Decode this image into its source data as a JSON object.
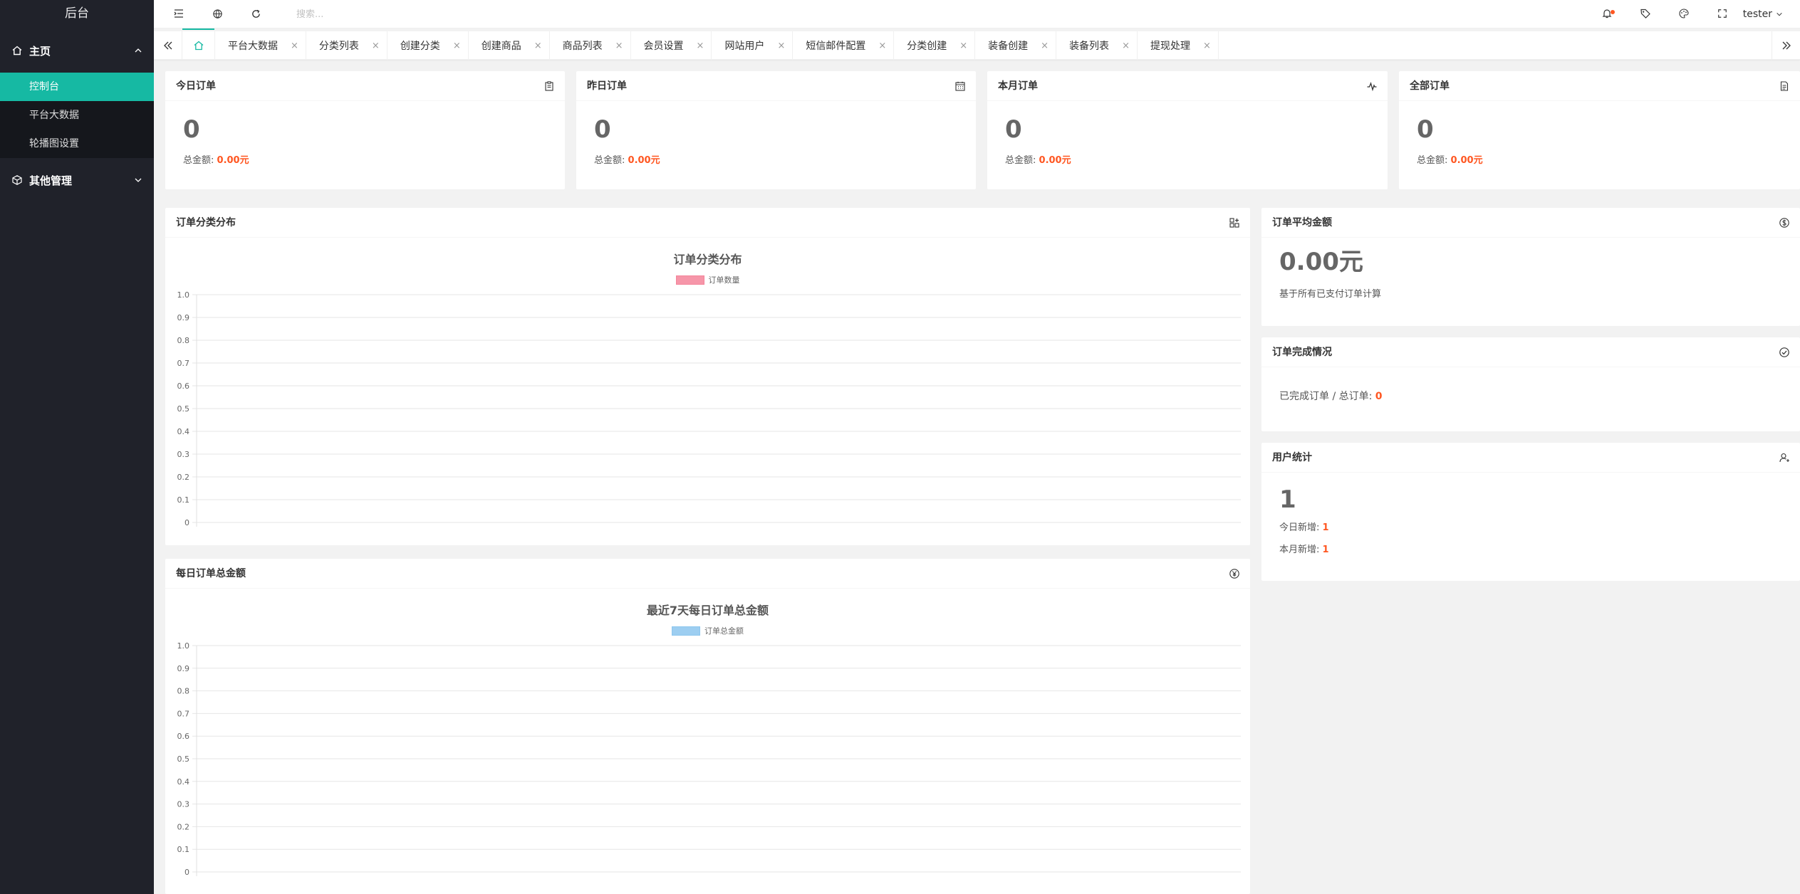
{
  "app": {
    "title": "后台"
  },
  "sidebar": {
    "groups": [
      {
        "label": "主页",
        "icon": "home-icon",
        "expanded": true,
        "items": [
          {
            "label": "控制台",
            "active": true
          },
          {
            "label": "平台大数据"
          },
          {
            "label": "轮播图设置"
          }
        ]
      },
      {
        "label": "其他管理",
        "icon": "cube-icon",
        "expanded": false,
        "items": []
      }
    ]
  },
  "header": {
    "search_placeholder": "搜索...",
    "user": "tester",
    "has_notification": true
  },
  "tabs": {
    "items": [
      "平台大数据",
      "分类列表",
      "创建分类",
      "创建商品",
      "商品列表",
      "会员设置",
      "网站用户",
      "短信邮件配置",
      "分类创建",
      "装备创建",
      "装备列表",
      "提现处理"
    ],
    "close_glyph": "×"
  },
  "stats": [
    {
      "title": "今日订单",
      "icon": "clipboard-icon",
      "value": "0",
      "amount_label": "总金额:",
      "amount": "0.00元"
    },
    {
      "title": "昨日订单",
      "icon": "calendar-icon",
      "value": "0",
      "amount_label": "总金额:",
      "amount": "0.00元"
    },
    {
      "title": "本月订单",
      "icon": "pulse-icon",
      "value": "0",
      "amount_label": "总金额:",
      "amount": "0.00元"
    },
    {
      "title": "全部订单",
      "icon": "document-icon",
      "value": "0",
      "amount_label": "总金额:",
      "amount": "0.00元"
    }
  ],
  "panels": {
    "category": {
      "title": "订单分类分布",
      "icon": "apps-icon"
    },
    "daily": {
      "title": "每日订单总金额",
      "icon": "yen-icon"
    },
    "avg": {
      "title": "订单平均金额",
      "icon": "dollar-icon",
      "value": "0.00元",
      "note": "基于所有已支付订单计算"
    },
    "completion": {
      "title": "订单完成情况",
      "icon": "check-circle-icon",
      "label": "已完成订单 / 总订单:",
      "value": "0"
    },
    "users": {
      "title": "用户统计",
      "icon": "user-icon",
      "value": "1",
      "today_label": "今日新增:",
      "today": "1",
      "month_label": "本月新增:",
      "month": "1"
    }
  },
  "chart_data": [
    {
      "type": "bar",
      "title": "订单分类分布",
      "categories": [],
      "series": [
        {
          "name": "订单数量",
          "values": [],
          "color": "#f4849a"
        }
      ],
      "ylim": [
        0,
        1
      ],
      "yticks": [
        "0",
        "0.1",
        "0.2",
        "0.3",
        "0.4",
        "0.5",
        "0.6",
        "0.7",
        "0.8",
        "0.9",
        "1.0"
      ],
      "grid": true,
      "legend": "top"
    },
    {
      "type": "bar",
      "title": "最近7天每日订单总金额",
      "categories": [],
      "series": [
        {
          "name": "订单总金额",
          "values": [],
          "color": "#8cc6ee"
        }
      ],
      "ylim": [
        0,
        1
      ],
      "yticks": [
        "0",
        "0.1",
        "0.2",
        "0.3",
        "0.4",
        "0.5",
        "0.6",
        "0.7",
        "0.8",
        "0.9",
        "1.0"
      ],
      "grid": true,
      "legend": "top"
    }
  ]
}
